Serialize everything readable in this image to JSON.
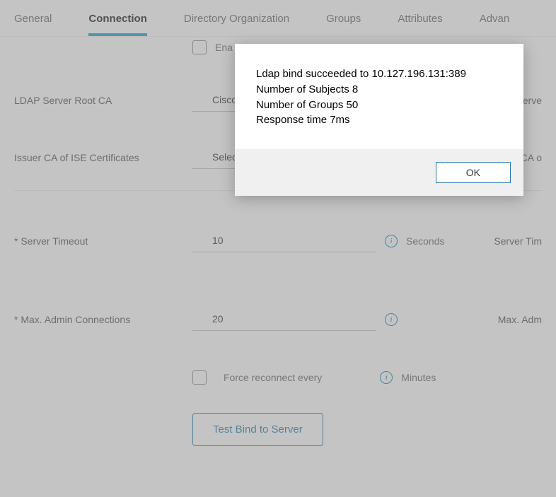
{
  "tabs": {
    "general": "General",
    "connection": "Connection",
    "directory_org": "Directory Organization",
    "groups": "Groups",
    "attributes": "Attributes",
    "advanced": "Advan"
  },
  "enable_row": {
    "label": "Ena"
  },
  "root_ca": {
    "label": "LDAP Server Root CA",
    "value": "Cisco",
    "right_label": "Serve"
  },
  "issuer_ca": {
    "label": "Issuer CA of ISE Certificates",
    "value": "Selec",
    "right_label": "CA o"
  },
  "server_timeout": {
    "label": "* Server Timeout",
    "value": "10",
    "unit": "Seconds",
    "right_label": "Server Tim"
  },
  "max_admin": {
    "label": "* Max. Admin Connections",
    "value": "20",
    "right_label": "Max. Adm"
  },
  "force_reconnect": {
    "label": "Force reconnect every",
    "unit": "Minutes"
  },
  "test_button": "Test Bind to Server",
  "modal": {
    "line1": "Ldap bind succeeded to 10.127.196.131:389",
    "line2": "Number of Subjects 8",
    "line3": "Number of Groups 50",
    "line4": "Response time 7ms",
    "ok": "OK"
  },
  "info_glyph": "i"
}
